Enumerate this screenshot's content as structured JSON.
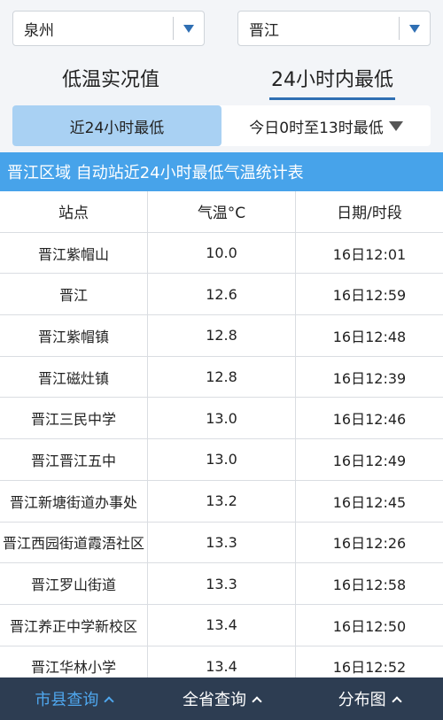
{
  "selectors": {
    "city": "泉州",
    "county": "晋江"
  },
  "mode_tabs": [
    {
      "label": "低温实况值",
      "active": false
    },
    {
      "label": "24小时内最低",
      "active": true
    }
  ],
  "sub_tabs": {
    "active_label": "近24小时最低",
    "other_label": "今日0时至13时最低"
  },
  "title": "晋江区域 自动站近24小时最低气温统计表",
  "table": {
    "headers": [
      "站点",
      "气温°C",
      "日期/时段"
    ],
    "rows": [
      [
        "晋江紫帽山",
        "10.0",
        "16日12:01"
      ],
      [
        "晋江",
        "12.6",
        "16日12:59"
      ],
      [
        "晋江紫帽镇",
        "12.8",
        "16日12:48"
      ],
      [
        "晋江磁灶镇",
        "12.8",
        "16日12:39"
      ],
      [
        "晋江三民中学",
        "13.0",
        "16日12:46"
      ],
      [
        "晋江晋江五中",
        "13.0",
        "16日12:49"
      ],
      [
        "晋江新塘街道办事处",
        "13.2",
        "16日12:45"
      ],
      [
        "晋江西园街道霞浯社区",
        "13.3",
        "16日12:26"
      ],
      [
        "晋江罗山街道",
        "13.3",
        "16日12:58"
      ],
      [
        "晋江养正中学新校区",
        "13.4",
        "16日12:50"
      ],
      [
        "晋江华林小学",
        "13.4",
        "16日12:52"
      ]
    ]
  },
  "bottom_nav": [
    {
      "label": "市县查询",
      "active": true
    },
    {
      "label": "全省查询",
      "active": false
    },
    {
      "label": "分布图",
      "active": false
    }
  ],
  "colors": {
    "accent": "#47a3ea",
    "active_subtab": "#a9d1f3",
    "nav_bg": "#2d3d52",
    "nav_active": "#4fa7ee"
  }
}
